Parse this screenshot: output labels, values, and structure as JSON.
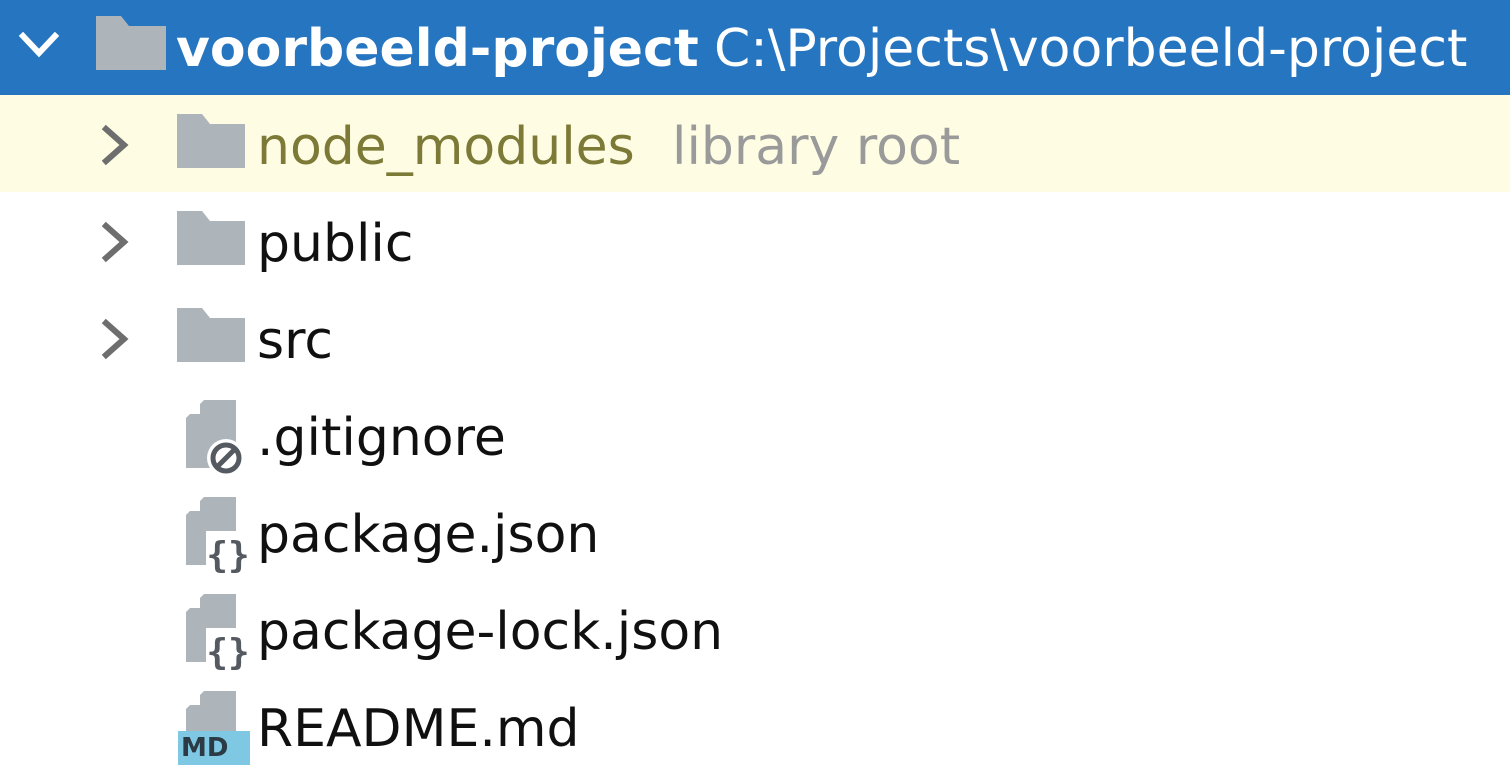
{
  "project": {
    "name": "voorbeeld-project",
    "path": "C:\\Projects\\voorbeeld-project",
    "icon": "folder-icon",
    "expanded": true
  },
  "children": [
    {
      "name": "node_modules",
      "hint": "library root",
      "kind": "folder",
      "icon": "folder-icon",
      "expanded": false,
      "highlighted": true
    },
    {
      "name": "public",
      "kind": "folder",
      "icon": "folder-icon",
      "expanded": false
    },
    {
      "name": "src",
      "kind": "folder",
      "icon": "folder-icon",
      "expanded": false
    },
    {
      "name": ".gitignore",
      "kind": "file",
      "icon": "gitignore-file-icon"
    },
    {
      "name": "package.json",
      "kind": "file",
      "icon": "json-file-icon"
    },
    {
      "name": "package-lock.json",
      "kind": "file",
      "icon": "json-file-icon"
    },
    {
      "name": "README.md",
      "kind": "file",
      "icon": "markdown-file-icon",
      "badge": "MD"
    }
  ],
  "colors": {
    "selection": "#2675c0",
    "library_row": "#fefde4",
    "library_text": "#7c7a36",
    "hint_text": "#9a9a9a",
    "folder_icon": "#adb5bb",
    "markdown_badge": "#7ec8e3"
  }
}
